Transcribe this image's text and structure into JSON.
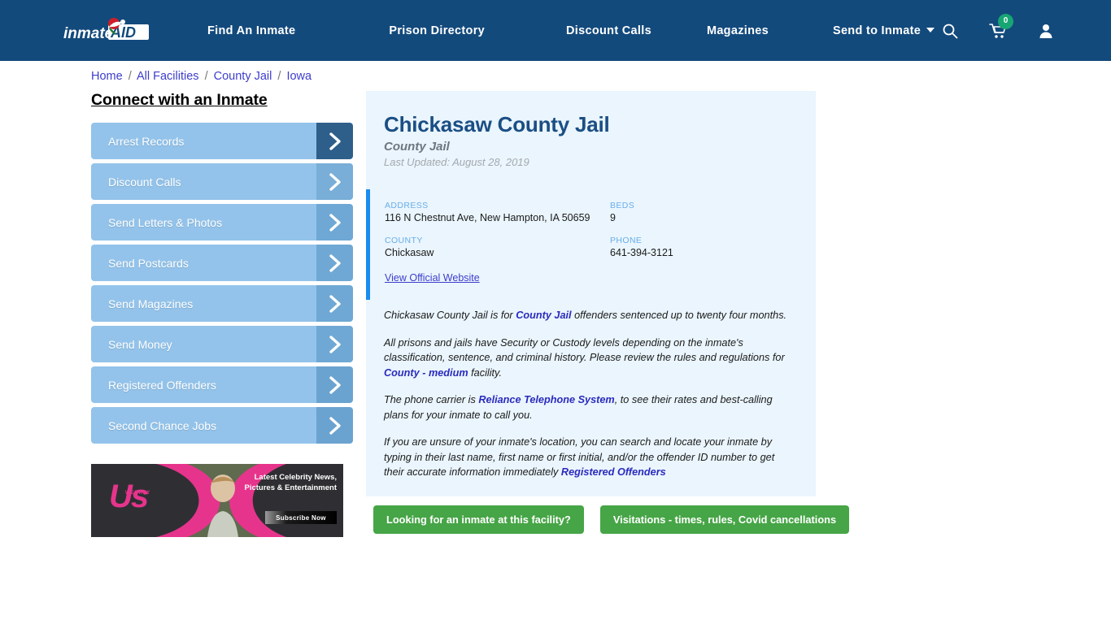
{
  "navbar": {
    "brand": "inmateAID",
    "brand_part1": "inmate",
    "brand_part2": "AID",
    "links": [
      {
        "label": "Find An Inmate"
      },
      {
        "label": "Prison Directory"
      },
      {
        "label": "Discount Calls"
      },
      {
        "label": "Magazines"
      },
      {
        "label": "Send to Inmate"
      }
    ],
    "cart_count": "0",
    "colors": {
      "background": "#134A7C",
      "badge": "#17A673"
    }
  },
  "breadcrumb": {
    "items": [
      "Home",
      "All Facilities",
      "County Jail",
      "Iowa"
    ],
    "separator": "/"
  },
  "sidebar": {
    "title": "Connect with an Inmate",
    "items": [
      {
        "label": "Arrest Records"
      },
      {
        "label": "Discount Calls"
      },
      {
        "label": "Send Letters & Photos"
      },
      {
        "label": "Send Postcards"
      },
      {
        "label": "Send Magazines"
      },
      {
        "label": "Send Money"
      },
      {
        "label": "Registered Offenders"
      },
      {
        "label": "Second Chance Jobs"
      }
    ],
    "colors": {
      "button": "#93C3EA",
      "chevron_box": "#6FA8D4",
      "chevron_box_first": "#2E5F8A"
    }
  },
  "ad": {
    "logo": "Us",
    "logo_sub": "WEEKLY",
    "headline": "Latest Celebrity News, Pictures & Entertainment",
    "cta": "Subscribe Now"
  },
  "facility": {
    "name": "Chickasaw County Jail",
    "type": "County Jail",
    "last_updated": "Last Updated: August 28, 2019",
    "fields": [
      {
        "label": "ADDRESS",
        "value": "116 N Chestnut Ave, New Hampton, IA 50659"
      },
      {
        "label": "BEDS",
        "value": "9"
      },
      {
        "label": "COUNTY",
        "value": "Chickasaw"
      },
      {
        "label": "PHONE",
        "value": "641-394-3121"
      }
    ],
    "official_website_link": "View Official Website",
    "accent_color": "#1A8CF0"
  },
  "body": {
    "p1_a": "Chickasaw County Jail is for ",
    "p1_link": "County Jail",
    "p1_b": " offenders sentenced up to twenty four months.",
    "p2_a": "All prisons and jails have Security or Custody levels depending on the inmate's classification, sentence, and criminal history. Please review the rules and regulations for ",
    "p2_link": "County - medium",
    "p2_b": " facility.",
    "p3_a": "The phone carrier is ",
    "p3_link": "Reliance Telephone System",
    "p3_b": ", to see their rates and best-calling plans for your inmate to call you.",
    "p4_a": "If you are unsure of your inmate's location, you can search and locate your inmate by typing in their last name, first name or first initial, and/or the offender ID number to get their accurate information immediately ",
    "p4_link": "Registered Offenders"
  },
  "cta_buttons": [
    {
      "label": "Looking for an inmate at this facility?"
    },
    {
      "label": "Visitations - times, rules, Covid cancellations"
    }
  ]
}
